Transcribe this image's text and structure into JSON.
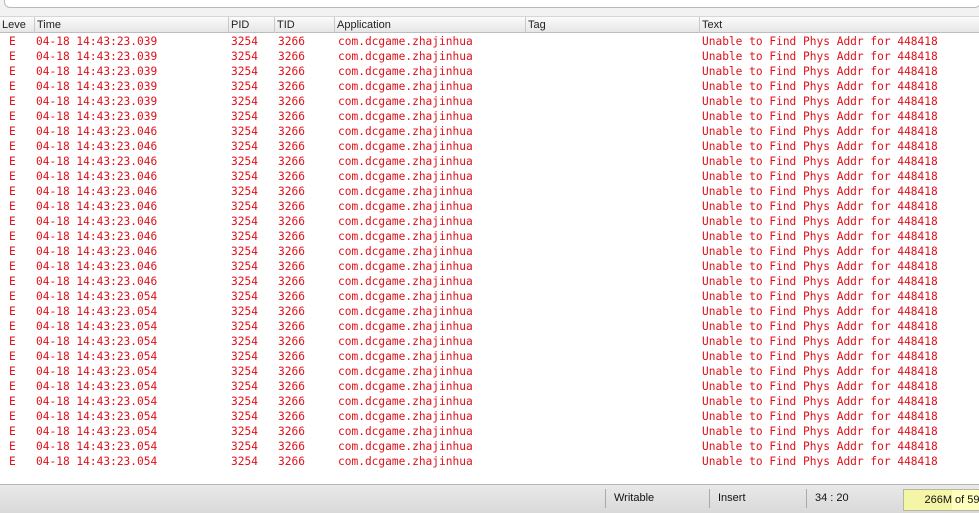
{
  "columns": {
    "level": "Leve",
    "time": "Time",
    "pid": "PID",
    "tid": "TID",
    "application": "Application",
    "tag": "Tag",
    "text": "Text"
  },
  "log_rows": [
    {
      "level": "E",
      "time": "04-18 14:43:23.039",
      "pid": "3254",
      "tid": "3266",
      "application": "com.dcgame.zhajinhua",
      "tag": "",
      "text": "Unable to Find Phys Addr for 448418"
    },
    {
      "level": "E",
      "time": "04-18 14:43:23.039",
      "pid": "3254",
      "tid": "3266",
      "application": "com.dcgame.zhajinhua",
      "tag": "",
      "text": "Unable to Find Phys Addr for 448418"
    },
    {
      "level": "E",
      "time": "04-18 14:43:23.039",
      "pid": "3254",
      "tid": "3266",
      "application": "com.dcgame.zhajinhua",
      "tag": "",
      "text": "Unable to Find Phys Addr for 448418"
    },
    {
      "level": "E",
      "time": "04-18 14:43:23.039",
      "pid": "3254",
      "tid": "3266",
      "application": "com.dcgame.zhajinhua",
      "tag": "",
      "text": "Unable to Find Phys Addr for 448418"
    },
    {
      "level": "E",
      "time": "04-18 14:43:23.039",
      "pid": "3254",
      "tid": "3266",
      "application": "com.dcgame.zhajinhua",
      "tag": "",
      "text": "Unable to Find Phys Addr for 448418"
    },
    {
      "level": "E",
      "time": "04-18 14:43:23.039",
      "pid": "3254",
      "tid": "3266",
      "application": "com.dcgame.zhajinhua",
      "tag": "",
      "text": "Unable to Find Phys Addr for 448418"
    },
    {
      "level": "E",
      "time": "04-18 14:43:23.046",
      "pid": "3254",
      "tid": "3266",
      "application": "com.dcgame.zhajinhua",
      "tag": "",
      "text": "Unable to Find Phys Addr for 448418"
    },
    {
      "level": "E",
      "time": "04-18 14:43:23.046",
      "pid": "3254",
      "tid": "3266",
      "application": "com.dcgame.zhajinhua",
      "tag": "",
      "text": "Unable to Find Phys Addr for 448418"
    },
    {
      "level": "E",
      "time": "04-18 14:43:23.046",
      "pid": "3254",
      "tid": "3266",
      "application": "com.dcgame.zhajinhua",
      "tag": "",
      "text": "Unable to Find Phys Addr for 448418"
    },
    {
      "level": "E",
      "time": "04-18 14:43:23.046",
      "pid": "3254",
      "tid": "3266",
      "application": "com.dcgame.zhajinhua",
      "tag": "",
      "text": "Unable to Find Phys Addr for 448418"
    },
    {
      "level": "E",
      "time": "04-18 14:43:23.046",
      "pid": "3254",
      "tid": "3266",
      "application": "com.dcgame.zhajinhua",
      "tag": "",
      "text": "Unable to Find Phys Addr for 448418"
    },
    {
      "level": "E",
      "time": "04-18 14:43:23.046",
      "pid": "3254",
      "tid": "3266",
      "application": "com.dcgame.zhajinhua",
      "tag": "",
      "text": "Unable to Find Phys Addr for 448418"
    },
    {
      "level": "E",
      "time": "04-18 14:43:23.046",
      "pid": "3254",
      "tid": "3266",
      "application": "com.dcgame.zhajinhua",
      "tag": "",
      "text": "Unable to Find Phys Addr for 448418"
    },
    {
      "level": "E",
      "time": "04-18 14:43:23.046",
      "pid": "3254",
      "tid": "3266",
      "application": "com.dcgame.zhajinhua",
      "tag": "",
      "text": "Unable to Find Phys Addr for 448418"
    },
    {
      "level": "E",
      "time": "04-18 14:43:23.046",
      "pid": "3254",
      "tid": "3266",
      "application": "com.dcgame.zhajinhua",
      "tag": "",
      "text": "Unable to Find Phys Addr for 448418"
    },
    {
      "level": "E",
      "time": "04-18 14:43:23.046",
      "pid": "3254",
      "tid": "3266",
      "application": "com.dcgame.zhajinhua",
      "tag": "",
      "text": "Unable to Find Phys Addr for 448418"
    },
    {
      "level": "E",
      "time": "04-18 14:43:23.046",
      "pid": "3254",
      "tid": "3266",
      "application": "com.dcgame.zhajinhua",
      "tag": "",
      "text": "Unable to Find Phys Addr for 448418"
    },
    {
      "level": "E",
      "time": "04-18 14:43:23.054",
      "pid": "3254",
      "tid": "3266",
      "application": "com.dcgame.zhajinhua",
      "tag": "",
      "text": "Unable to Find Phys Addr for 448418"
    },
    {
      "level": "E",
      "time": "04-18 14:43:23.054",
      "pid": "3254",
      "tid": "3266",
      "application": "com.dcgame.zhajinhua",
      "tag": "",
      "text": "Unable to Find Phys Addr for 448418"
    },
    {
      "level": "E",
      "time": "04-18 14:43:23.054",
      "pid": "3254",
      "tid": "3266",
      "application": "com.dcgame.zhajinhua",
      "tag": "",
      "text": "Unable to Find Phys Addr for 448418"
    },
    {
      "level": "E",
      "time": "04-18 14:43:23.054",
      "pid": "3254",
      "tid": "3266",
      "application": "com.dcgame.zhajinhua",
      "tag": "",
      "text": "Unable to Find Phys Addr for 448418"
    },
    {
      "level": "E",
      "time": "04-18 14:43:23.054",
      "pid": "3254",
      "tid": "3266",
      "application": "com.dcgame.zhajinhua",
      "tag": "",
      "text": "Unable to Find Phys Addr for 448418"
    },
    {
      "level": "E",
      "time": "04-18 14:43:23.054",
      "pid": "3254",
      "tid": "3266",
      "application": "com.dcgame.zhajinhua",
      "tag": "",
      "text": "Unable to Find Phys Addr for 448418"
    },
    {
      "level": "E",
      "time": "04-18 14:43:23.054",
      "pid": "3254",
      "tid": "3266",
      "application": "com.dcgame.zhajinhua",
      "tag": "",
      "text": "Unable to Find Phys Addr for 448418"
    },
    {
      "level": "E",
      "time": "04-18 14:43:23.054",
      "pid": "3254",
      "tid": "3266",
      "application": "com.dcgame.zhajinhua",
      "tag": "",
      "text": "Unable to Find Phys Addr for 448418"
    },
    {
      "level": "E",
      "time": "04-18 14:43:23.054",
      "pid": "3254",
      "tid": "3266",
      "application": "com.dcgame.zhajinhua",
      "tag": "",
      "text": "Unable to Find Phys Addr for 448418"
    },
    {
      "level": "E",
      "time": "04-18 14:43:23.054",
      "pid": "3254",
      "tid": "3266",
      "application": "com.dcgame.zhajinhua",
      "tag": "",
      "text": "Unable to Find Phys Addr for 448418"
    },
    {
      "level": "E",
      "time": "04-18 14:43:23.054",
      "pid": "3254",
      "tid": "3266",
      "application": "com.dcgame.zhajinhua",
      "tag": "",
      "text": "Unable to Find Phys Addr for 448418"
    },
    {
      "level": "E",
      "time": "04-18 14:43:23.054",
      "pid": "3254",
      "tid": "3266",
      "application": "com.dcgame.zhajinhua",
      "tag": "",
      "text": "Unable to Find Phys Addr for 448418"
    }
  ],
  "log_text_color": "#e0101a",
  "status_bar": {
    "writable": "Writable",
    "insert_mode": "Insert",
    "cursor_position": "34 : 20",
    "memory_used": "266M",
    "memory_total": "of 59"
  }
}
